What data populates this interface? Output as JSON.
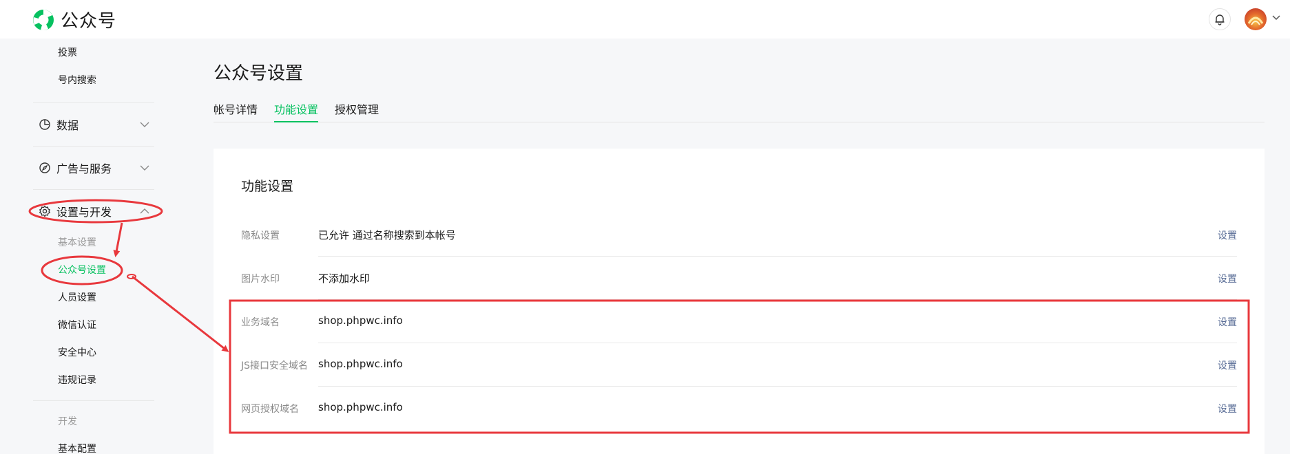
{
  "app": {
    "name": "公众号",
    "brand_color": "#07c160",
    "link_color": "#576b95"
  },
  "header": {
    "bell_icon": "bell-icon",
    "avatar_icon": "avatar",
    "menu_caret": "chevron-down-icon"
  },
  "sidebar": {
    "top_items": [
      {
        "label": "投票"
      },
      {
        "label": "号内搜索"
      }
    ],
    "data_label": "数据",
    "ads_label": "广告与服务",
    "settings_label": "设置与开发",
    "basic_group": "基本设置",
    "basic_items": [
      {
        "label": "公众号设置"
      },
      {
        "label": "人员设置"
      },
      {
        "label": "微信认证"
      },
      {
        "label": "安全中心"
      },
      {
        "label": "违规记录"
      }
    ],
    "dev_group": "开发",
    "dev_items": [
      {
        "label": "基本配置"
      }
    ]
  },
  "main": {
    "title": "公众号设置",
    "tabs": [
      {
        "label": "帐号详情"
      },
      {
        "label": "功能设置"
      },
      {
        "label": "授权管理"
      }
    ],
    "active_tab": "功能设置",
    "card_title": "功能设置",
    "rows": [
      {
        "label": "隐私设置",
        "value": "已允许 通过名称搜索到本帐号",
        "action": "设置"
      },
      {
        "label": "图片水印",
        "value": "不添加水印",
        "action": "设置"
      },
      {
        "label": "业务域名",
        "value": "shop.phpwc.info",
        "action": "设置"
      },
      {
        "label": "JS接口安全域名",
        "value": "shop.phpwc.info",
        "action": "设置"
      },
      {
        "label": "网页授权域名",
        "value": "shop.phpwc.info",
        "action": "设置"
      }
    ]
  },
  "annotation_color": "#e8383d"
}
